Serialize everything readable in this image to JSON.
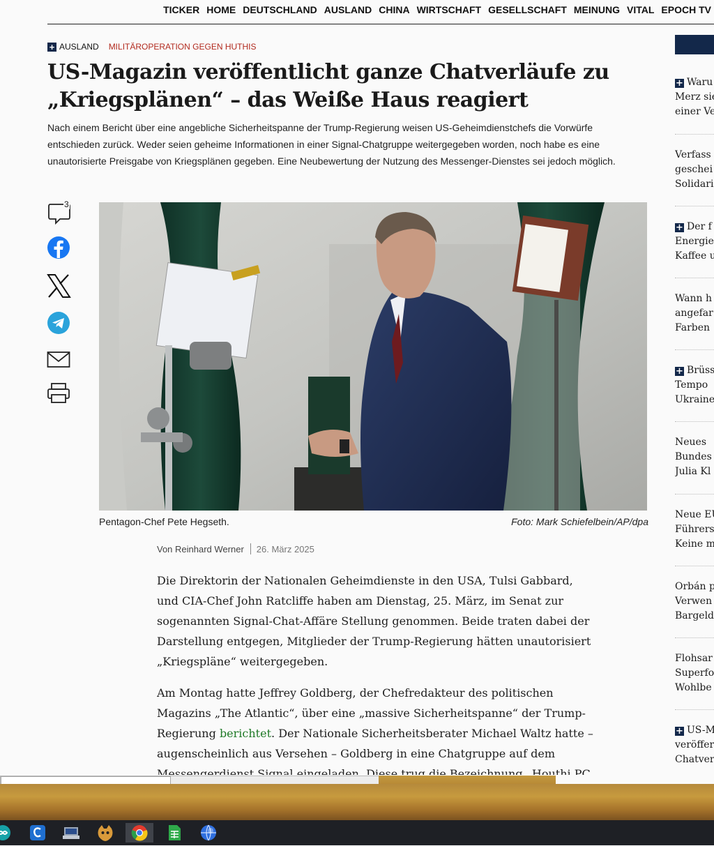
{
  "nav": {
    "items": [
      "TICKER",
      "HOME",
      "DEUTSCHLAND",
      "AUSLAND",
      "CHINA",
      "WIRTSCHAFT",
      "GESELLSCHAFT",
      "MEINUNG",
      "VITAL",
      "EPOCH TV"
    ]
  },
  "article": {
    "kicker_plus": "+",
    "section": "AUSLAND",
    "topic": "MILITÄROPERATION GEGEN HUTHIS",
    "title": "US-Magazin veröffentlicht ganze Chatverläufe zu „Kriegsplänen“ – das Weiße Haus reagiert",
    "lead": "Nach einem Bericht über eine angebliche Sicherheitspanne der Trump-Regierung weisen US-Geheimdienstchefs die Vorwürfe entschieden zurück. Weder seien geheime Informationen in einer Signal-Chatgruppe weitergegeben worden, noch habe es eine unautorisierte Preisgabe von Kriegsplänen gegeben. Eine Neubewertung der Nutzung des Messenger-Dienstes sei jedoch möglich.",
    "comment_count": "3",
    "caption": "Pentagon-Chef Pete Hegseth.",
    "credit": "Foto: Mark Schiefelbein/AP/dpa",
    "author": "Von Reinhard Werner",
    "date": "26. März 2025",
    "p1": "Die Direktorin der Nationalen Geheimdienste in den USA, Tulsi Gabbard, und CIA-Chef John Ratcliffe haben am Dienstag, 25. März, im Senat zur sogenannten Signal-Chat-Affäre Stellung genommen. Beide traten dabei der Darstellung entgegen, Mitglieder der Trump-Regierung hätten unautorisiert „Kriegspläne“ weitergegeben.",
    "p2_a": "Am Montag hatte Jeffrey Goldberg, der Chefredakteur des politischen Magazins „The Atlantic“, über eine „massive Sicherheitspanne“ der Trump-Regierung ",
    "p2_link": "berichtet",
    "p2_b": ". Der Nationale Sicherheitsberater Michael Waltz hatte – augenscheinlich aus Versehen – Goldberg in eine Chatgruppe auf dem Messengerdienst Signal eingeladen. Diese trug die Bezeichnung „Houthi PC"
  },
  "share": {
    "icons": [
      "comment-icon",
      "facebook-icon",
      "x-icon",
      "telegram-icon",
      "email-icon",
      "print-icon"
    ]
  },
  "sidebar": {
    "items": [
      {
        "plus": true,
        "lines": [
          "Waru",
          "Merz sie",
          "einer Ve"
        ]
      },
      {
        "plus": false,
        "lines": [
          "Verfass",
          "geschei",
          "Solidari"
        ]
      },
      {
        "plus": true,
        "lines": [
          "Der f",
          "Energie",
          "Kaffee u"
        ]
      },
      {
        "plus": false,
        "lines": [
          "Wann h",
          "angefar",
          "Farben"
        ]
      },
      {
        "plus": true,
        "lines": [
          "Brüss",
          "Tempo",
          "Ukraine"
        ]
      },
      {
        "plus": false,
        "lines": [
          "Neues",
          "Bundes",
          "Julia Kl"
        ]
      },
      {
        "plus": false,
        "lines": [
          "Neue EU",
          "Führers",
          "Keine m"
        ]
      },
      {
        "plus": false,
        "lines": [
          "Orbán p",
          "Verwen",
          "Bargeld"
        ]
      },
      {
        "plus": false,
        "lines": [
          "Flohsar",
          "Superfo",
          "Wohlbe"
        ]
      },
      {
        "plus": true,
        "lines": [
          "US-M",
          "veröffer",
          "Chatver"
        ]
      }
    ]
  },
  "colors": {
    "navy": "#13284a",
    "topic_red": "#b22a1e",
    "link_green": "#1f7a27"
  },
  "taskbar": {
    "apps": [
      "arduino-icon",
      "ccleaner-icon",
      "network-icon",
      "cat-app-icon",
      "chrome-icon",
      "spreadsheet-icon",
      "browser-globe-icon"
    ]
  }
}
